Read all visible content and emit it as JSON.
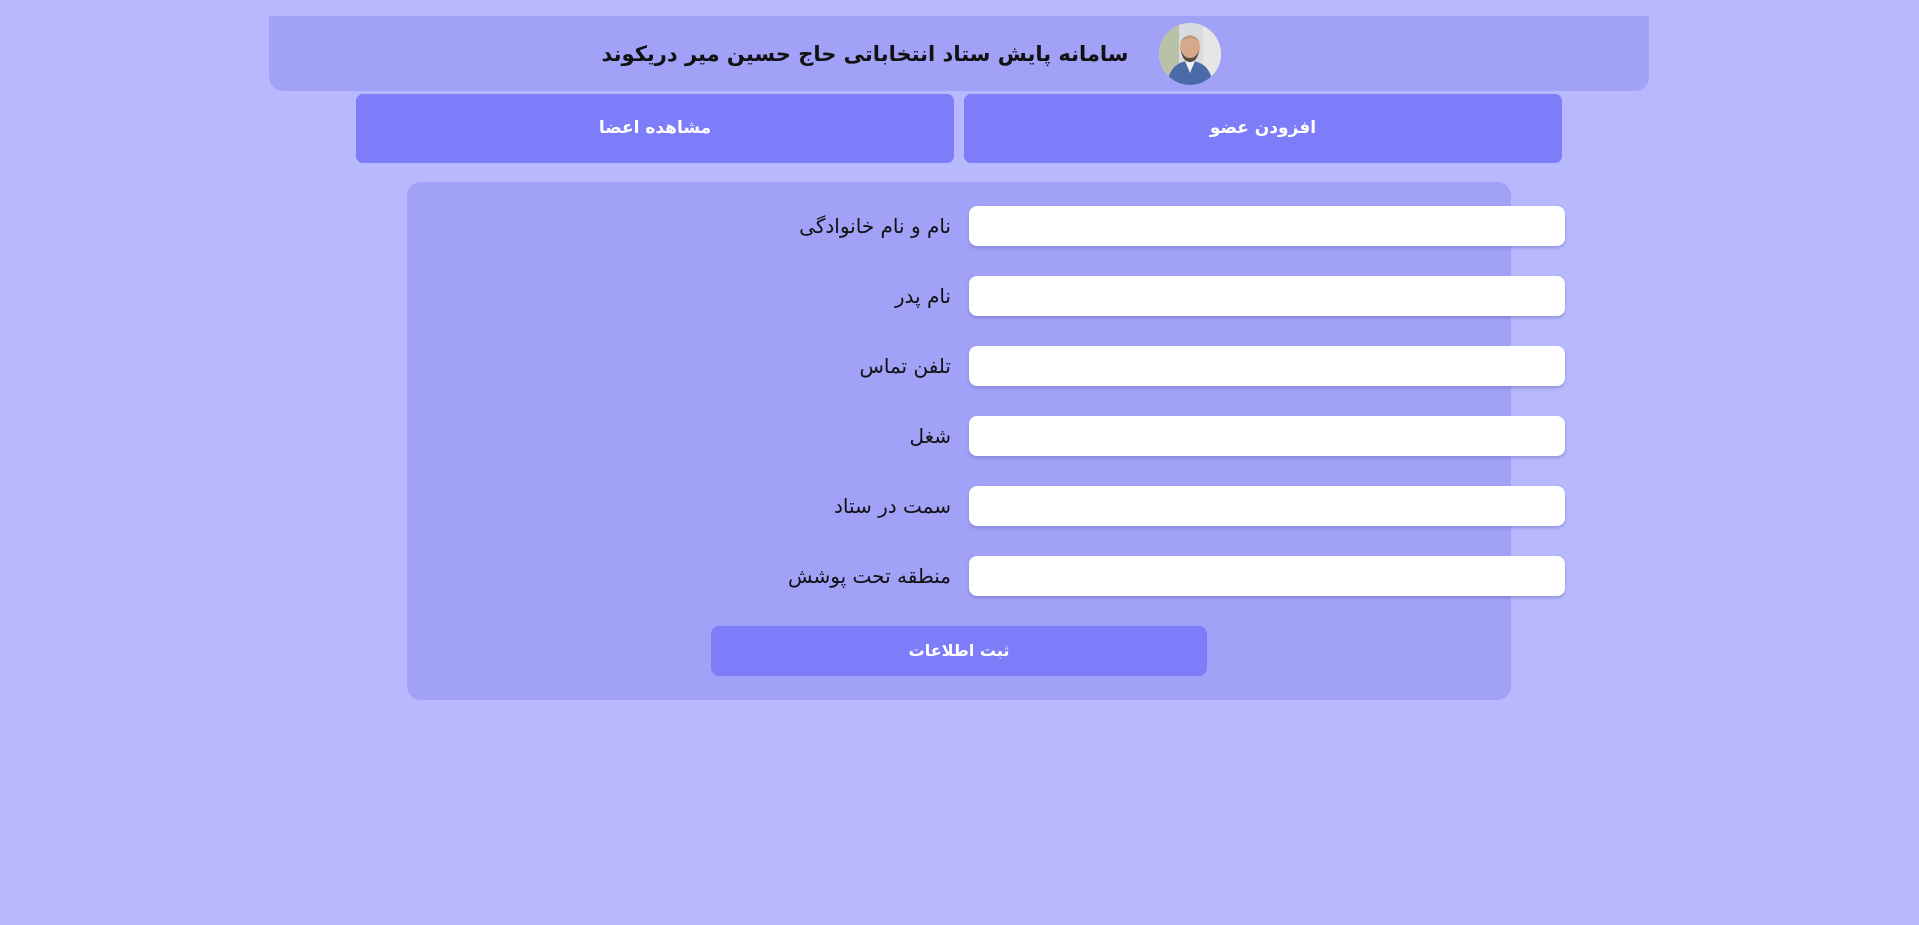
{
  "header": {
    "title": "سامانه پایش ستاد انتخاباتی حاج حسین میر دریکوند",
    "avatar_icon": "person-portrait"
  },
  "nav": {
    "add_member_label": "افزودن عضو",
    "view_members_label": "مشاهده اعضا"
  },
  "form": {
    "fields": [
      {
        "label": "نام و نام خانوادگی",
        "value": ""
      },
      {
        "label": "نام پدر",
        "value": ""
      },
      {
        "label": "تلفن تماس",
        "value": ""
      },
      {
        "label": "شغل",
        "value": ""
      },
      {
        "label": "سمت در ستاد",
        "value": ""
      },
      {
        "label": "منطقه تحت پوشش",
        "value": ""
      }
    ],
    "submit_label": "ثبت اطلاعات"
  },
  "colors": {
    "page_background": "#b8b8fd",
    "panel_background": "#a1a1f7",
    "button_background": "#7d7dfa",
    "button_text": "#ffffff"
  }
}
